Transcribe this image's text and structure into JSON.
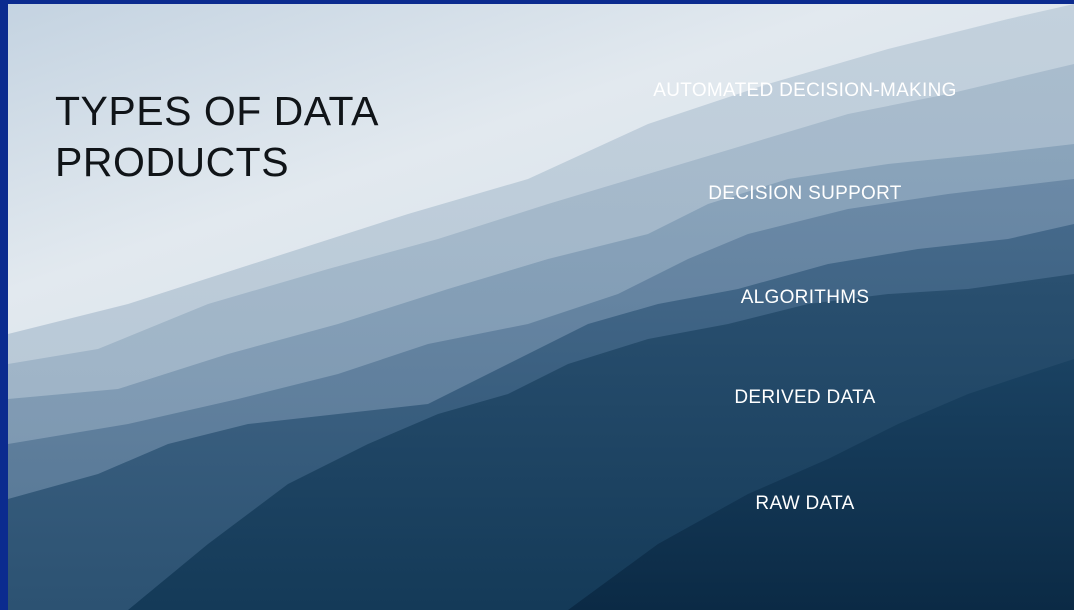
{
  "slide": {
    "title_lines": [
      "TYPES OF DATA",
      "PRODUCTS"
    ],
    "layers": [
      {
        "label": "AUTOMATED DECISION-MAKING"
      },
      {
        "label": "DECISION SUPPORT"
      },
      {
        "label": "ALGORITHMS"
      },
      {
        "label": "DERIVED DATA"
      },
      {
        "label": "RAW DATA"
      }
    ]
  },
  "colors": {
    "frame": "#0b2b8f",
    "sky_top": "#b9cbdc",
    "sky_mid": "#dfe7ee",
    "mountain_dark": "#0e2f4c",
    "title_text": "#101418",
    "layer_text": "#ffffff"
  }
}
